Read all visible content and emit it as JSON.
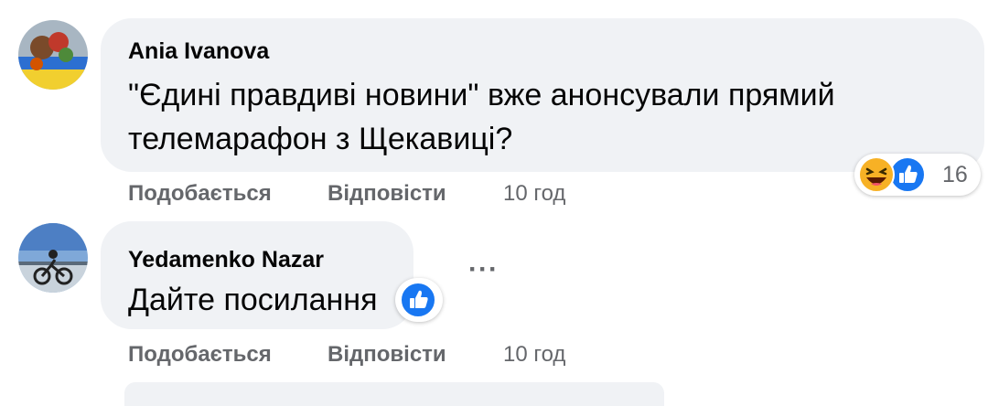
{
  "comments": [
    {
      "author": "Ania Ivanova",
      "line1": "\"Єдині правдиві новини\" вже анонсували прямий",
      "line2": "телемарафон з Щекавиці?",
      "like_label": "Подобається",
      "reply_label": "Відповісти",
      "time": "10 год",
      "reaction_count": "16",
      "reactions": [
        "haha-icon",
        "like-icon"
      ]
    },
    {
      "author": "Yedamenko Nazar",
      "text": "Дайте посилання",
      "like_label": "Подобається",
      "reply_label": "Відповісти",
      "time": "10 год",
      "reactions": [
        "like-icon"
      ],
      "more_label": "···"
    }
  ],
  "colors": {
    "bubble": "#f0f2f5",
    "text": "#050505",
    "secondary": "#65676b",
    "like_blue": "#1877f2",
    "haha_yellow": "#f7b125"
  }
}
